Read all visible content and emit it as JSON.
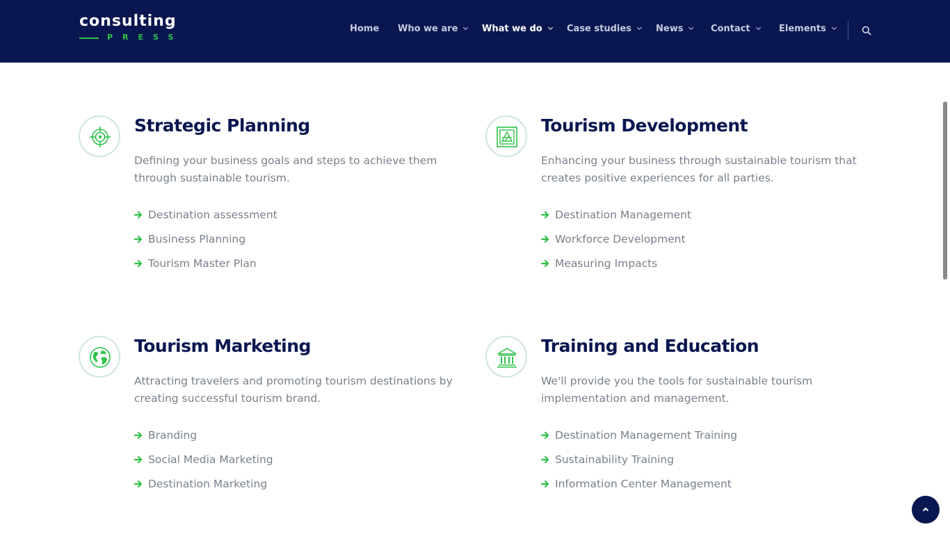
{
  "brand": {
    "name": "consulting",
    "tagline": "PRESS",
    "accent": "#2fc149",
    "navy": "#0a1650"
  },
  "nav": {
    "items": [
      {
        "label": "Home",
        "has_dropdown": false,
        "active": false
      },
      {
        "label": "Who we are",
        "has_dropdown": true,
        "active": false
      },
      {
        "label": "What we do",
        "has_dropdown": true,
        "active": true
      },
      {
        "label": "Case studies",
        "has_dropdown": true,
        "active": false
      },
      {
        "label": "News",
        "has_dropdown": true,
        "active": false
      },
      {
        "label": "Contact",
        "has_dropdown": true,
        "active": false
      },
      {
        "label": "Elements",
        "has_dropdown": true,
        "active": false
      }
    ],
    "search_icon": "search-icon"
  },
  "services": [
    {
      "icon": "target-icon",
      "title": "Strategic Planning",
      "description": "Defining your business goals and steps to achieve them through sustainable tourism.",
      "items": [
        "Destination assessment",
        "Business Planning",
        "Tourism Master Plan"
      ]
    },
    {
      "icon": "map-icon",
      "title": "Tourism Development",
      "description": "Enhancing your business through sustainable tourism that creates positive experiences for all parties.",
      "items": [
        "Destination Management",
        "Workforce Development",
        "Measuring Impacts"
      ]
    },
    {
      "icon": "globe-icon",
      "title": "Tourism Marketing",
      "description": "Attracting travelers and promoting tourism destinations by creating successful tourism brand.",
      "items": [
        "Branding",
        "Social Media Marketing",
        "Destination Marketing"
      ]
    },
    {
      "icon": "institution-icon",
      "title": "Training and Education",
      "description": "We'll provide you the tools for sustainable tourism implementation and management.",
      "items": [
        "Destination Management Training",
        "Sustainability Training",
        "Information Center Management"
      ]
    }
  ],
  "back_to_top_icon": "chevron-up-icon"
}
